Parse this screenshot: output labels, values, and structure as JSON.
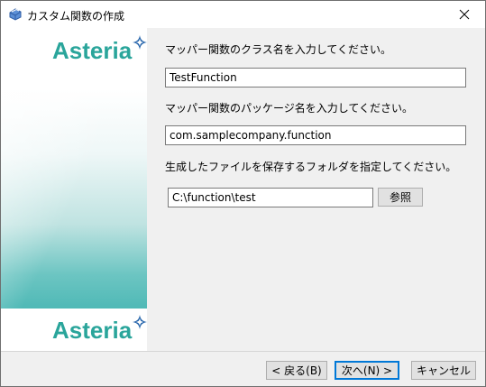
{
  "window": {
    "title": "カスタム関数の作成"
  },
  "brand": {
    "logo_text": "Asteria",
    "accent_color": "#2aa59b",
    "gradient_color": "#4fb9b6"
  },
  "form": {
    "class_name_label": "マッパー関数のクラス名を入力してください。",
    "class_name_value": "TestFunction",
    "package_label": "マッパー関数のパッケージ名を入力してください。",
    "package_value": "com.samplecompany.function",
    "folder_label": "生成したファイルを保存するフォルダを指定してください。",
    "folder_value": "C:\\function\\test",
    "browse_label": "参照"
  },
  "buttons": {
    "back_label": "< 戻る(B)",
    "next_label": "次へ(N) >",
    "cancel_label": "キャンセル"
  },
  "icons": {
    "app": "app-icon",
    "close": "close-icon",
    "sparkle": "sparkle-icon"
  }
}
